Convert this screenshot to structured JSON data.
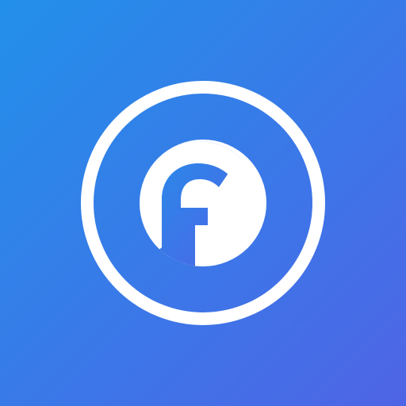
{
  "icon": {
    "name": "app-logo-icon",
    "description_glyph": "f",
    "colors": {
      "gradient_start": "#2290EA",
      "gradient_end": "#4F64E6",
      "foreground": "#FFFFFF"
    }
  }
}
